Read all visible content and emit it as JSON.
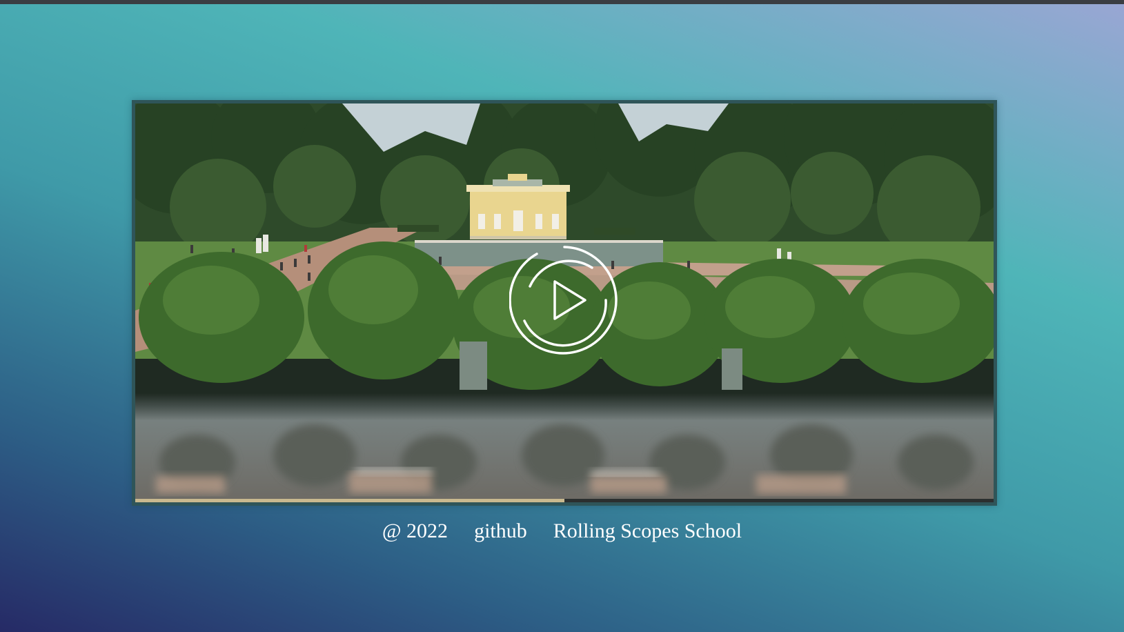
{
  "player": {
    "progress": 0.5
  },
  "footer": {
    "year": "@ 2022",
    "github_label": "github",
    "school_label": "Rolling Scopes School"
  },
  "icons": {
    "play": "play-icon"
  },
  "colors": {
    "progress_fill": "#c9b98f",
    "progress_track": "#2b2f2f",
    "footer_text": "#ffffff"
  }
}
